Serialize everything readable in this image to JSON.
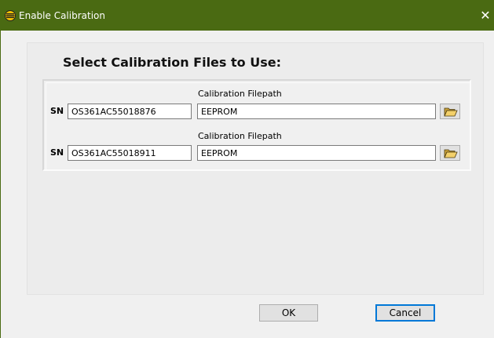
{
  "window": {
    "title": "Enable Calibration",
    "close_glyph": "✕"
  },
  "heading": "Select Calibration Files to Use:",
  "rows": [
    {
      "sn_label": "SN",
      "sn_value": "OS361AC55018876",
      "path_label": "Calibration Filepath",
      "path_value": "EEPROM",
      "browse_icon": "folder-open-icon"
    },
    {
      "sn_label": "SN",
      "sn_value": "OS361AC55018911",
      "path_label": "Calibration Filepath",
      "path_value": "EEPROM",
      "browse_icon": "folder-open-icon"
    }
  ],
  "buttons": {
    "ok_label": "OK",
    "cancel_label": "Cancel"
  },
  "colors": {
    "titlebar": "#4a6a12",
    "default_button_border": "#0078d7"
  }
}
